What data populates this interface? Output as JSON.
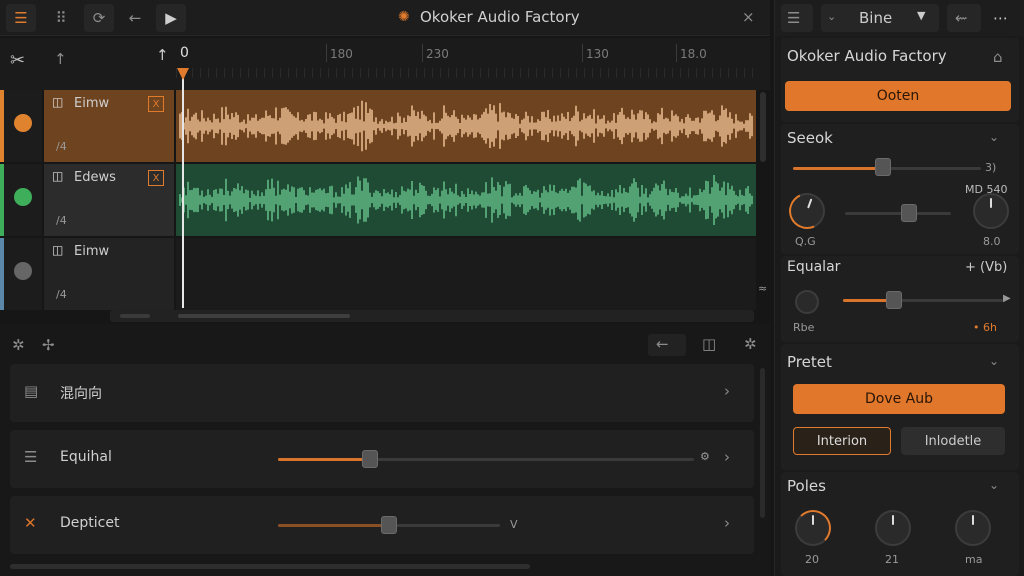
{
  "app": {
    "title": "Okoker Audio Factory"
  },
  "toolbar": {
    "close_glyph": "×"
  },
  "ruler": {
    "start_label": "0",
    "ticks": [
      "180",
      "230",
      "130",
      "18.0"
    ]
  },
  "tracks": [
    {
      "name": "Eimw",
      "meter": "/4",
      "color": "#e0832e",
      "badge": "X"
    },
    {
      "name": "Edews",
      "meter": "/4",
      "color": "#3fae5a",
      "badge": "X"
    },
    {
      "name": "Eimw",
      "meter": "/4",
      "color": "#5b87a8",
      "badge": ""
    }
  ],
  "bottom": {
    "rows": [
      {
        "label": "混向向"
      },
      {
        "label": "Equihal",
        "slider": 0.22,
        "end_glyph": "⚙"
      },
      {
        "label": "Depticet",
        "slider": 0.5,
        "end_glyph": "V"
      }
    ]
  },
  "right": {
    "preset_select": "Bine",
    "title": "Okoker Audio Factory",
    "primary_button": "Ooten",
    "section_seeok": {
      "title": "Seeok",
      "slider": 0.48,
      "end_label": "3)",
      "knob_left_label": "Q.G",
      "knob_right_label": "8.0",
      "knob_right_tag": "MD 540",
      "slider2": 0.6
    },
    "section_equalizer": {
      "title": "Equalar",
      "right_label": "+ (Vb)",
      "slider": 0.32,
      "knob_label": "Rbe",
      "end_label": "• 6h"
    },
    "section_preset": {
      "title": "Pretet",
      "main_button": "Dove Aub",
      "btn_a": "Interion",
      "btn_b": "Inlodetle"
    },
    "section_poles": {
      "title": "Poles",
      "values": [
        "20",
        "21",
        "ma"
      ]
    }
  },
  "colors": {
    "accent": "#e07a2c",
    "track1": "#c97a3a",
    "track2": "#3a8a56"
  }
}
